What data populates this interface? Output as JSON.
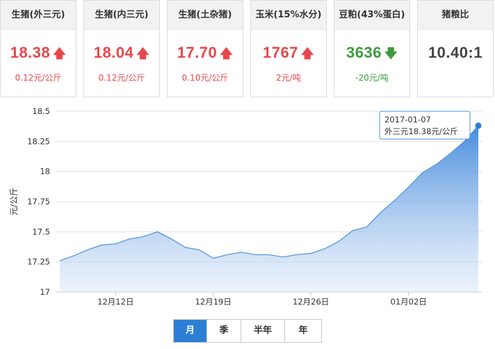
{
  "cards": [
    {
      "title": "生猪(外三元)",
      "value": "18.38",
      "direction": "up",
      "arrow": "🡅",
      "change": "0.12元/公斤"
    },
    {
      "title": "生猪(内三元)",
      "value": "18.04",
      "direction": "up",
      "arrow": "🡅",
      "change": "0.12元/公斤"
    },
    {
      "title": "生猪(土杂猪)",
      "value": "17.70",
      "direction": "up",
      "arrow": "🡅",
      "change": "0.10元/公斤"
    },
    {
      "title": "玉米(15%水分)",
      "value": "1767",
      "direction": "up",
      "arrow": "🡅",
      "change": "2元/吨"
    },
    {
      "title": "豆粕(43%蛋白)",
      "value": "3636",
      "direction": "down",
      "arrow": "🡇",
      "change": "-20元/吨"
    },
    {
      "title": "猪粮比",
      "value": "10.40:1",
      "direction": "none",
      "arrow": "",
      "change": ""
    }
  ],
  "colors": {
    "up": "#e8474b",
    "down": "#3c9b3c",
    "line": "#4a90d9",
    "point": "#2d7fd6",
    "active_tab": "#2d7fd6"
  },
  "chart_data": {
    "type": "area",
    "ylabel": "元/公斤",
    "ylim": [
      17,
      18.5
    ],
    "yticks": [
      "17",
      "17.25",
      "17.5",
      "17.75",
      "18",
      "18.25",
      "18.5"
    ],
    "xticks": [
      {
        "label": "12月12日",
        "index": 4
      },
      {
        "label": "12月19日",
        "index": 11
      },
      {
        "label": "12月26日",
        "index": 18
      },
      {
        "label": "01月02日",
        "index": 25
      }
    ],
    "x": [
      "12-08",
      "12-09",
      "12-10",
      "12-11",
      "12-12",
      "12-13",
      "12-14",
      "12-15",
      "12-16",
      "12-17",
      "12-18",
      "12-19",
      "12-20",
      "12-21",
      "12-22",
      "12-23",
      "12-24",
      "12-25",
      "12-26",
      "12-27",
      "12-28",
      "12-29",
      "12-30",
      "12-31",
      "01-01",
      "01-02",
      "01-03",
      "01-04",
      "01-05",
      "01-06",
      "01-07"
    ],
    "values": [
      17.26,
      17.3,
      17.35,
      17.39,
      17.4,
      17.44,
      17.46,
      17.5,
      17.44,
      17.37,
      17.35,
      17.28,
      17.31,
      17.33,
      17.31,
      17.31,
      17.29,
      17.31,
      17.32,
      17.36,
      17.42,
      17.51,
      17.54,
      17.66,
      17.76,
      17.87,
      17.99,
      18.06,
      18.15,
      18.25,
      18.38
    ],
    "tooltip": {
      "date": "2017-01-07",
      "text": "外三元18.38元/公斤"
    },
    "grid": true
  },
  "range_tabs": [
    {
      "label": "月",
      "active": true
    },
    {
      "label": "季",
      "active": false
    },
    {
      "label": "半年",
      "active": false
    },
    {
      "label": "年",
      "active": false
    }
  ]
}
